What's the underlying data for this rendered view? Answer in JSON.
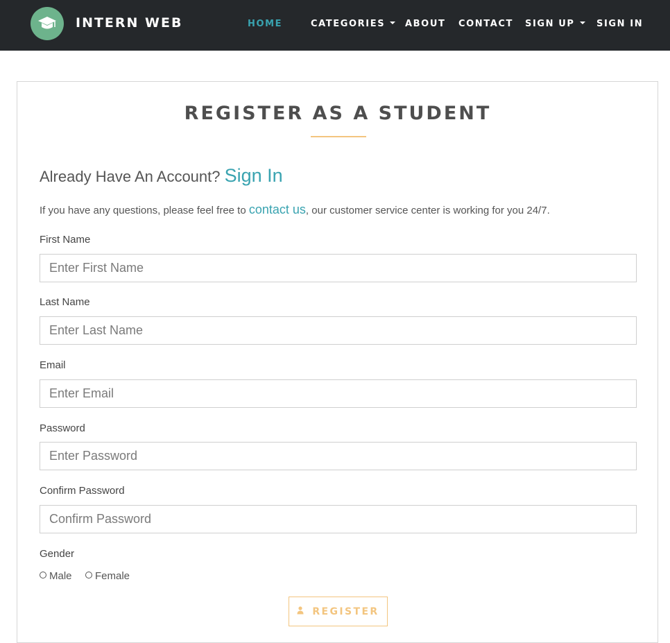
{
  "navbar": {
    "brand": "INTERN WEB",
    "logo_icon": "graduation-cap-icon",
    "items": [
      {
        "label": "HOME",
        "active": true
      },
      {
        "label": "CATEGORIES",
        "dropdown": true
      },
      {
        "label": "ABOUT"
      },
      {
        "label": "CONTACT"
      },
      {
        "label": "SIGN UP",
        "dropdown": true
      },
      {
        "label": "SIGN IN"
      }
    ]
  },
  "page": {
    "title": "REGISTER AS A STUDENT",
    "already_text": "Already Have An Account?",
    "signin_link": "Sign In",
    "help_before": "If you have any questions, please feel free to",
    "help_link": "contact us",
    "help_after": ", our customer service center is working for you 24/7."
  },
  "form": {
    "first_name": {
      "label": "First Name",
      "placeholder": "Enter First Name",
      "value": ""
    },
    "last_name": {
      "label": "Last Name",
      "placeholder": "Enter Last Name",
      "value": ""
    },
    "email": {
      "label": "Email",
      "placeholder": "Enter Email",
      "value": ""
    },
    "password": {
      "label": "Password",
      "placeholder": "Enter Password",
      "value": ""
    },
    "confirm_password": {
      "label": "Confirm Password",
      "placeholder": "Confirm Password",
      "value": ""
    },
    "gender": {
      "label": "Gender",
      "options": [
        "Male",
        "Female"
      ],
      "selected": null
    },
    "submit_label": "REGISTER",
    "submit_icon": "user-icon"
  },
  "colors": {
    "navbar_bg": "#25282b",
    "accent_teal": "#39a3b0",
    "accent_gold": "#f3c57f",
    "logo_green": "#6db38c"
  }
}
